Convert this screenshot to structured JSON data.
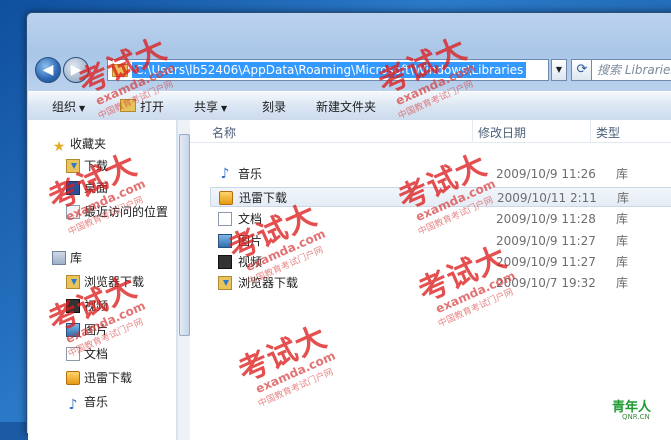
{
  "address": {
    "path": "C:\\Users\\lb52406\\AppData\\Roaming\\Microsoft\\Windows\\Libraries",
    "search_placeholder": "搜索 Libraries"
  },
  "toolbar": {
    "organize": "组织",
    "open": "打开",
    "share": "共享",
    "burn": "刻录",
    "new_folder": "新建文件夹"
  },
  "sidebar": {
    "favorites": "收藏夹",
    "downloads": "下载",
    "desktop": "桌面",
    "recent": "最近访问的位置",
    "libraries": "库",
    "browser_downloads": "浏览器下载",
    "videos": "视频",
    "pictures": "图片",
    "documents": "文档",
    "xunlei": "迅雷下载",
    "music": "音乐"
  },
  "columns": {
    "name": "名称",
    "modified": "修改日期",
    "type": "类型"
  },
  "files": [
    {
      "name": "音乐",
      "modified": "2009/10/9 11:26",
      "type": "库",
      "icon": "music-icon"
    },
    {
      "name": "迅雷下载",
      "modified": "2009/10/11 2:11",
      "type": "库",
      "icon": "xunlei-icon"
    },
    {
      "name": "文档",
      "modified": "2009/10/9 11:28",
      "type": "库",
      "icon": "document-icon"
    },
    {
      "name": "图片",
      "modified": "2009/10/9 11:27",
      "type": "库",
      "icon": "picture-icon"
    },
    {
      "name": "视频",
      "modified": "2009/10/9 11:27",
      "type": "库",
      "icon": "video-icon"
    },
    {
      "name": "浏览器下载",
      "modified": "2009/10/7 19:32",
      "type": "库",
      "icon": "download-icon"
    }
  ],
  "watermark": {
    "main": "考试大",
    "site": "examda.com",
    "sub": "中国教育考试门户网"
  },
  "corner_logo": {
    "text": "青年人",
    "site": "QNR.CN"
  }
}
